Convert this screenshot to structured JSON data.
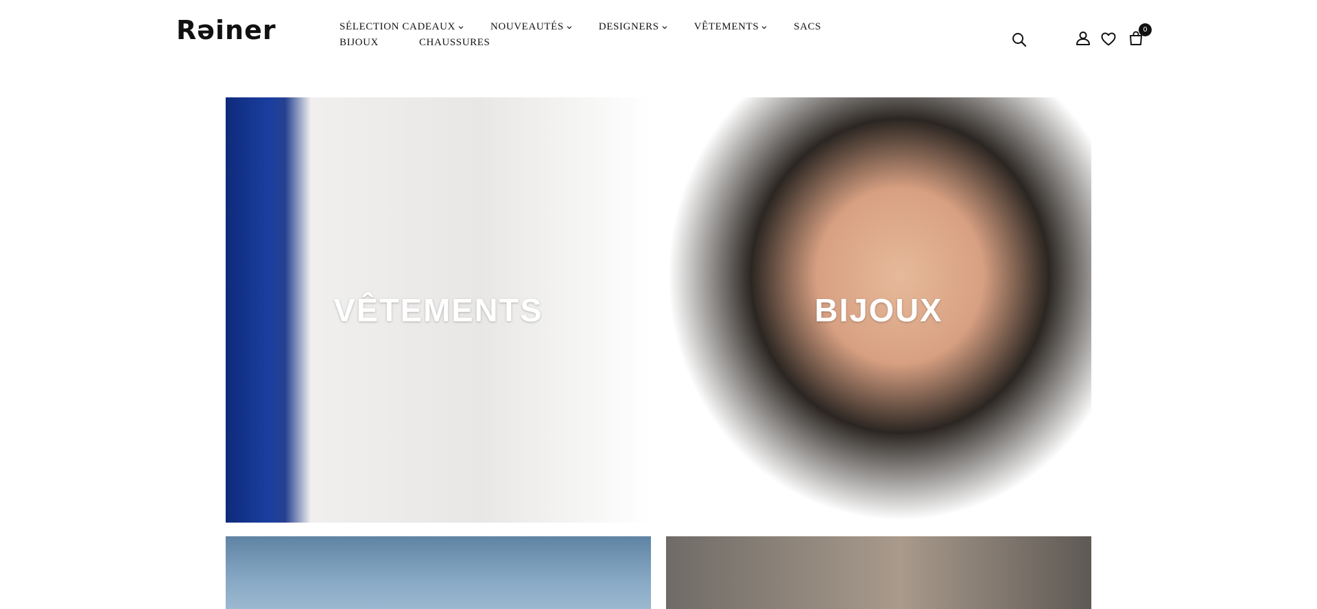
{
  "brand": {
    "name": "Rəiner"
  },
  "nav": {
    "items": [
      {
        "label": "SÉLECTION CADEAUX",
        "has_dropdown": true
      },
      {
        "label": "NOUVEAUTÉS",
        "has_dropdown": true
      },
      {
        "label": "DESIGNERS",
        "has_dropdown": true
      },
      {
        "label": "VÊTEMENTS",
        "has_dropdown": true
      },
      {
        "label": "SACS",
        "has_dropdown": false
      },
      {
        "label": "BIJOUX",
        "has_dropdown": false
      },
      {
        "label": "CHAUSSURES",
        "has_dropdown": false
      }
    ],
    "chevron": "⌄"
  },
  "header_icons": {
    "search": "search-icon",
    "account": "user-icon",
    "wishlist": "heart-icon",
    "cart": "bag-icon",
    "cart_count": "0"
  },
  "tiles": [
    {
      "label": "VÊTEMENTS"
    },
    {
      "label": "BIJOUX"
    },
    {
      "label": ""
    },
    {
      "label": ""
    }
  ],
  "colors": {
    "text": "#111111",
    "background": "#ffffff",
    "badge": "#111111",
    "tile_label": "#ffffff"
  }
}
